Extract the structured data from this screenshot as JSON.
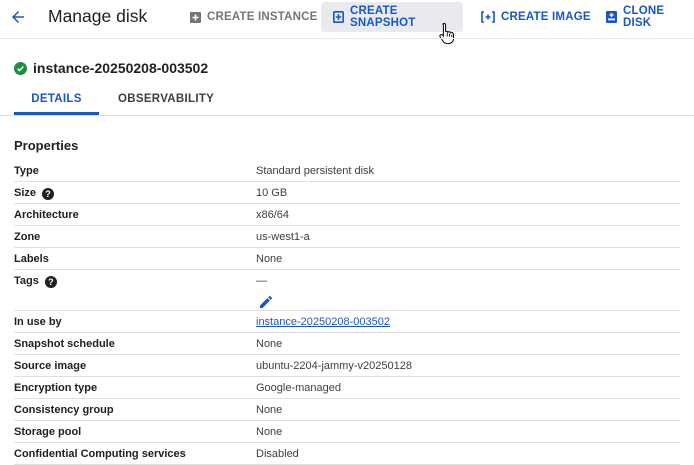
{
  "header": {
    "title": "Manage disk",
    "back_icon": "arrow-left-icon",
    "actions": [
      {
        "label": "CREATE INSTANCE",
        "icon": "create-instance-icon",
        "state": "disabled"
      },
      {
        "label": "CREATE SNAPSHOT",
        "icon": "snapshot-icon",
        "state": "hovered"
      },
      {
        "label": "CREATE IMAGE",
        "icon": "create-image-icon",
        "state": "enabled"
      },
      {
        "label": "CLONE DISK",
        "icon": "clone-disk-icon",
        "state": "enabled"
      }
    ]
  },
  "instance": {
    "name": "instance-20250208-003502",
    "status_icon": "check-circle-icon",
    "status_color": "#1e8e3e"
  },
  "tabs": [
    {
      "label": "DETAILS",
      "selected": true
    },
    {
      "label": "OBSERVABILITY",
      "selected": false
    }
  ],
  "properties": {
    "title": "Properties",
    "rows": [
      {
        "key": "Type",
        "value": "Standard persistent disk"
      },
      {
        "key": "Size",
        "value": "10 GB",
        "help": true
      },
      {
        "key": "Architecture",
        "value": "x86/64"
      },
      {
        "key": "Zone",
        "value": "us-west1-a"
      },
      {
        "key": "Labels",
        "value": "None"
      },
      {
        "key": "Tags",
        "value": "—",
        "help": true,
        "edit_icon": "pencil-icon"
      },
      {
        "key": "In use by",
        "value": "instance-20250208-003502",
        "link": true
      },
      {
        "key": "Snapshot schedule",
        "value": "None"
      },
      {
        "key": "Source image",
        "value": "ubuntu-2204-jammy-v20250128"
      },
      {
        "key": "Encryption type",
        "value": "Google-managed"
      },
      {
        "key": "Consistency group",
        "value": "None"
      },
      {
        "key": "Storage pool",
        "value": "None"
      },
      {
        "key": "Confidential Computing services",
        "value": "Disabled"
      }
    ]
  },
  "colors": {
    "accent": "#1a56c7",
    "disabled": "#757575",
    "hover_bg": "#e8eaed"
  }
}
